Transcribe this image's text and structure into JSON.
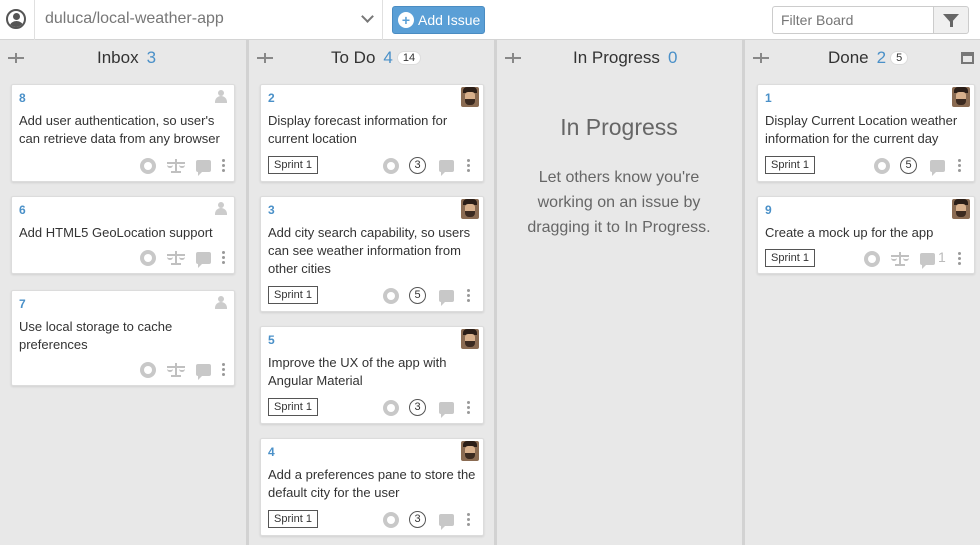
{
  "toolbar": {
    "repo": "duluca/local-weather-app",
    "add_issue_label": "Add Issue",
    "filter_placeholder": "Filter Board"
  },
  "columns": [
    {
      "title": "Inbox",
      "count": "3",
      "total": "",
      "cards": [
        {
          "number": "8",
          "title": "Add user authentication, so user's can retrieve data from any browser",
          "sprint": "",
          "estimate": "",
          "comments": ""
        },
        {
          "number": "6",
          "title": "Add HTML5 GeoLocation support",
          "sprint": "",
          "estimate": "",
          "comments": ""
        },
        {
          "number": "7",
          "title": "Use local storage to cache preferences",
          "sprint": "",
          "estimate": "",
          "comments": ""
        }
      ]
    },
    {
      "title": "To Do",
      "count": "4",
      "total": "14",
      "cards": [
        {
          "number": "2",
          "title": "Display forecast information for current location",
          "sprint": "Sprint 1",
          "estimate": "3",
          "comments": ""
        },
        {
          "number": "3",
          "title": "Add city search capability, so users can see weather information from other cities",
          "sprint": "Sprint 1",
          "estimate": "5",
          "comments": ""
        },
        {
          "number": "5",
          "title": "Improve the UX of the app with Angular Material",
          "sprint": "Sprint 1",
          "estimate": "3",
          "comments": ""
        },
        {
          "number": "4",
          "title": "Add a preferences pane to store the default city for the user",
          "sprint": "Sprint 1",
          "estimate": "3",
          "comments": ""
        }
      ]
    },
    {
      "title": "In Progress",
      "count": "0",
      "total": "",
      "empty_title": "In Progress",
      "empty_text": "Let others know you're working on an issue by dragging it to In Progress.",
      "cards": []
    },
    {
      "title": "Done",
      "count": "2",
      "total": "5",
      "cards": [
        {
          "number": "1",
          "title": "Display Current Location weather information for the current day",
          "sprint": "Sprint 1",
          "estimate": "5",
          "comments": ""
        },
        {
          "number": "9",
          "title": "Create a mock up for the app",
          "sprint": "Sprint 1",
          "estimate": "",
          "comments": "1"
        }
      ]
    }
  ]
}
